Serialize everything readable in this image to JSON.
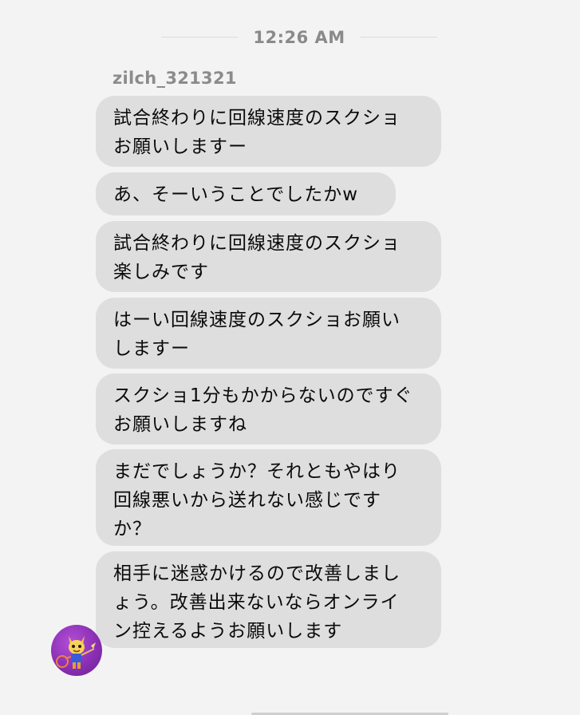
{
  "timestamp": "12:26 AM",
  "sender": {
    "username": "zilch_321321",
    "avatar_icon": "avatar-icon"
  },
  "messages": [
    {
      "text": "試合終わりに回線速度のスクショ\nお願いしますー"
    },
    {
      "text": "あ、そーいうことでしたかw"
    },
    {
      "text": "試合終わりに回線速度のスクショ\n楽しみです"
    },
    {
      "text": "はーい回線速度のスクショお願い\nしますー"
    },
    {
      "text": "スクショ1分もかからないのですぐ\nお願いしますね"
    },
    {
      "text": "まだでしょうか？それともやはり\n回線悪いから送れない感じです\nか？"
    },
    {
      "text": "相手に迷惑かけるので改善しまし\nょう。改善出来ないならオンライ\nン控えるようお願いします"
    }
  ],
  "colors": {
    "background": "#f3f3f3",
    "bubble": "#dedede",
    "avatar": "#8a2fb5",
    "meta_text": "#8a8a8a"
  }
}
